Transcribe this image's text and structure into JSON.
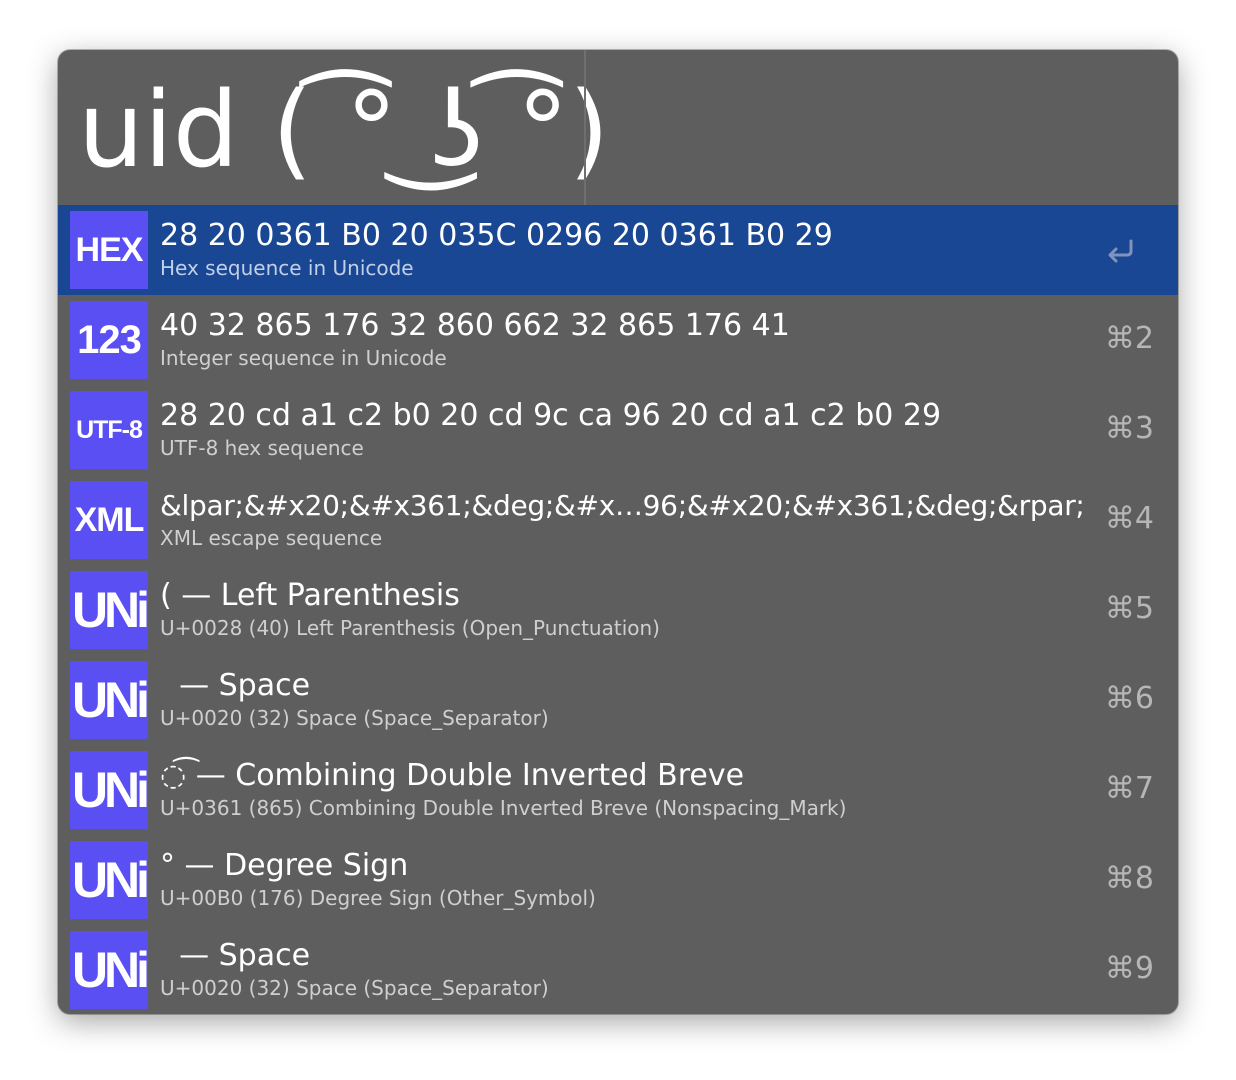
{
  "search": {
    "query": "uid ( ͡° ͜ʖ ͡°)"
  },
  "results": [
    {
      "badge": "HEX",
      "title": "28 20 0361 B0 20 035C 0296 20 0361 B0 29",
      "subtitle": "Hex sequence in Unicode",
      "shortcut": "",
      "selected": true,
      "action_icon": "return-icon"
    },
    {
      "badge": "123",
      "title": "40 32 865 176 32 860 662 32 865 176 41",
      "subtitle": "Integer sequence in Unicode",
      "shortcut": "⌘2"
    },
    {
      "badge": "UTF-8",
      "title": "28 20 cd a1 c2 b0 20 cd 9c ca 96 20 cd a1 c2 b0 29",
      "subtitle": "UTF-8 hex sequence",
      "shortcut": "⌘3"
    },
    {
      "badge": "XML",
      "title": "&lpar;&#x20;&#x361;&deg;&#x…96;&#x20;&#x361;&deg;&rpar;",
      "subtitle": "XML escape sequence",
      "shortcut": "⌘4"
    },
    {
      "badge": "UNi",
      "title": "( — Left Parenthesis",
      "subtitle": "U+0028 (40) Left Parenthesis (Open_Punctuation)",
      "shortcut": "⌘5"
    },
    {
      "badge": "UNi",
      "title": "  — Space",
      "subtitle": "U+0020 (32) Space (Space_Separator)",
      "shortcut": "⌘6"
    },
    {
      "badge": "UNi",
      "title": "◌͡ — Combining Double Inverted Breve",
      "subtitle": "U+0361 (865) Combining Double Inverted Breve (Nonspacing_Mark)",
      "shortcut": "⌘7"
    },
    {
      "badge": "UNi",
      "title": "° — Degree Sign",
      "subtitle": "U+00B0 (176) Degree Sign (Other_Symbol)",
      "shortcut": "⌘8"
    },
    {
      "badge": "UNi",
      "title": "  — Space",
      "subtitle": "U+0020 (32) Space (Space_Separator)",
      "shortcut": "⌘9"
    }
  ],
  "colors": {
    "window_bg": "#5e5e5e",
    "selected_row": "#1a4793",
    "badge_bg": "#5a4ff2"
  }
}
